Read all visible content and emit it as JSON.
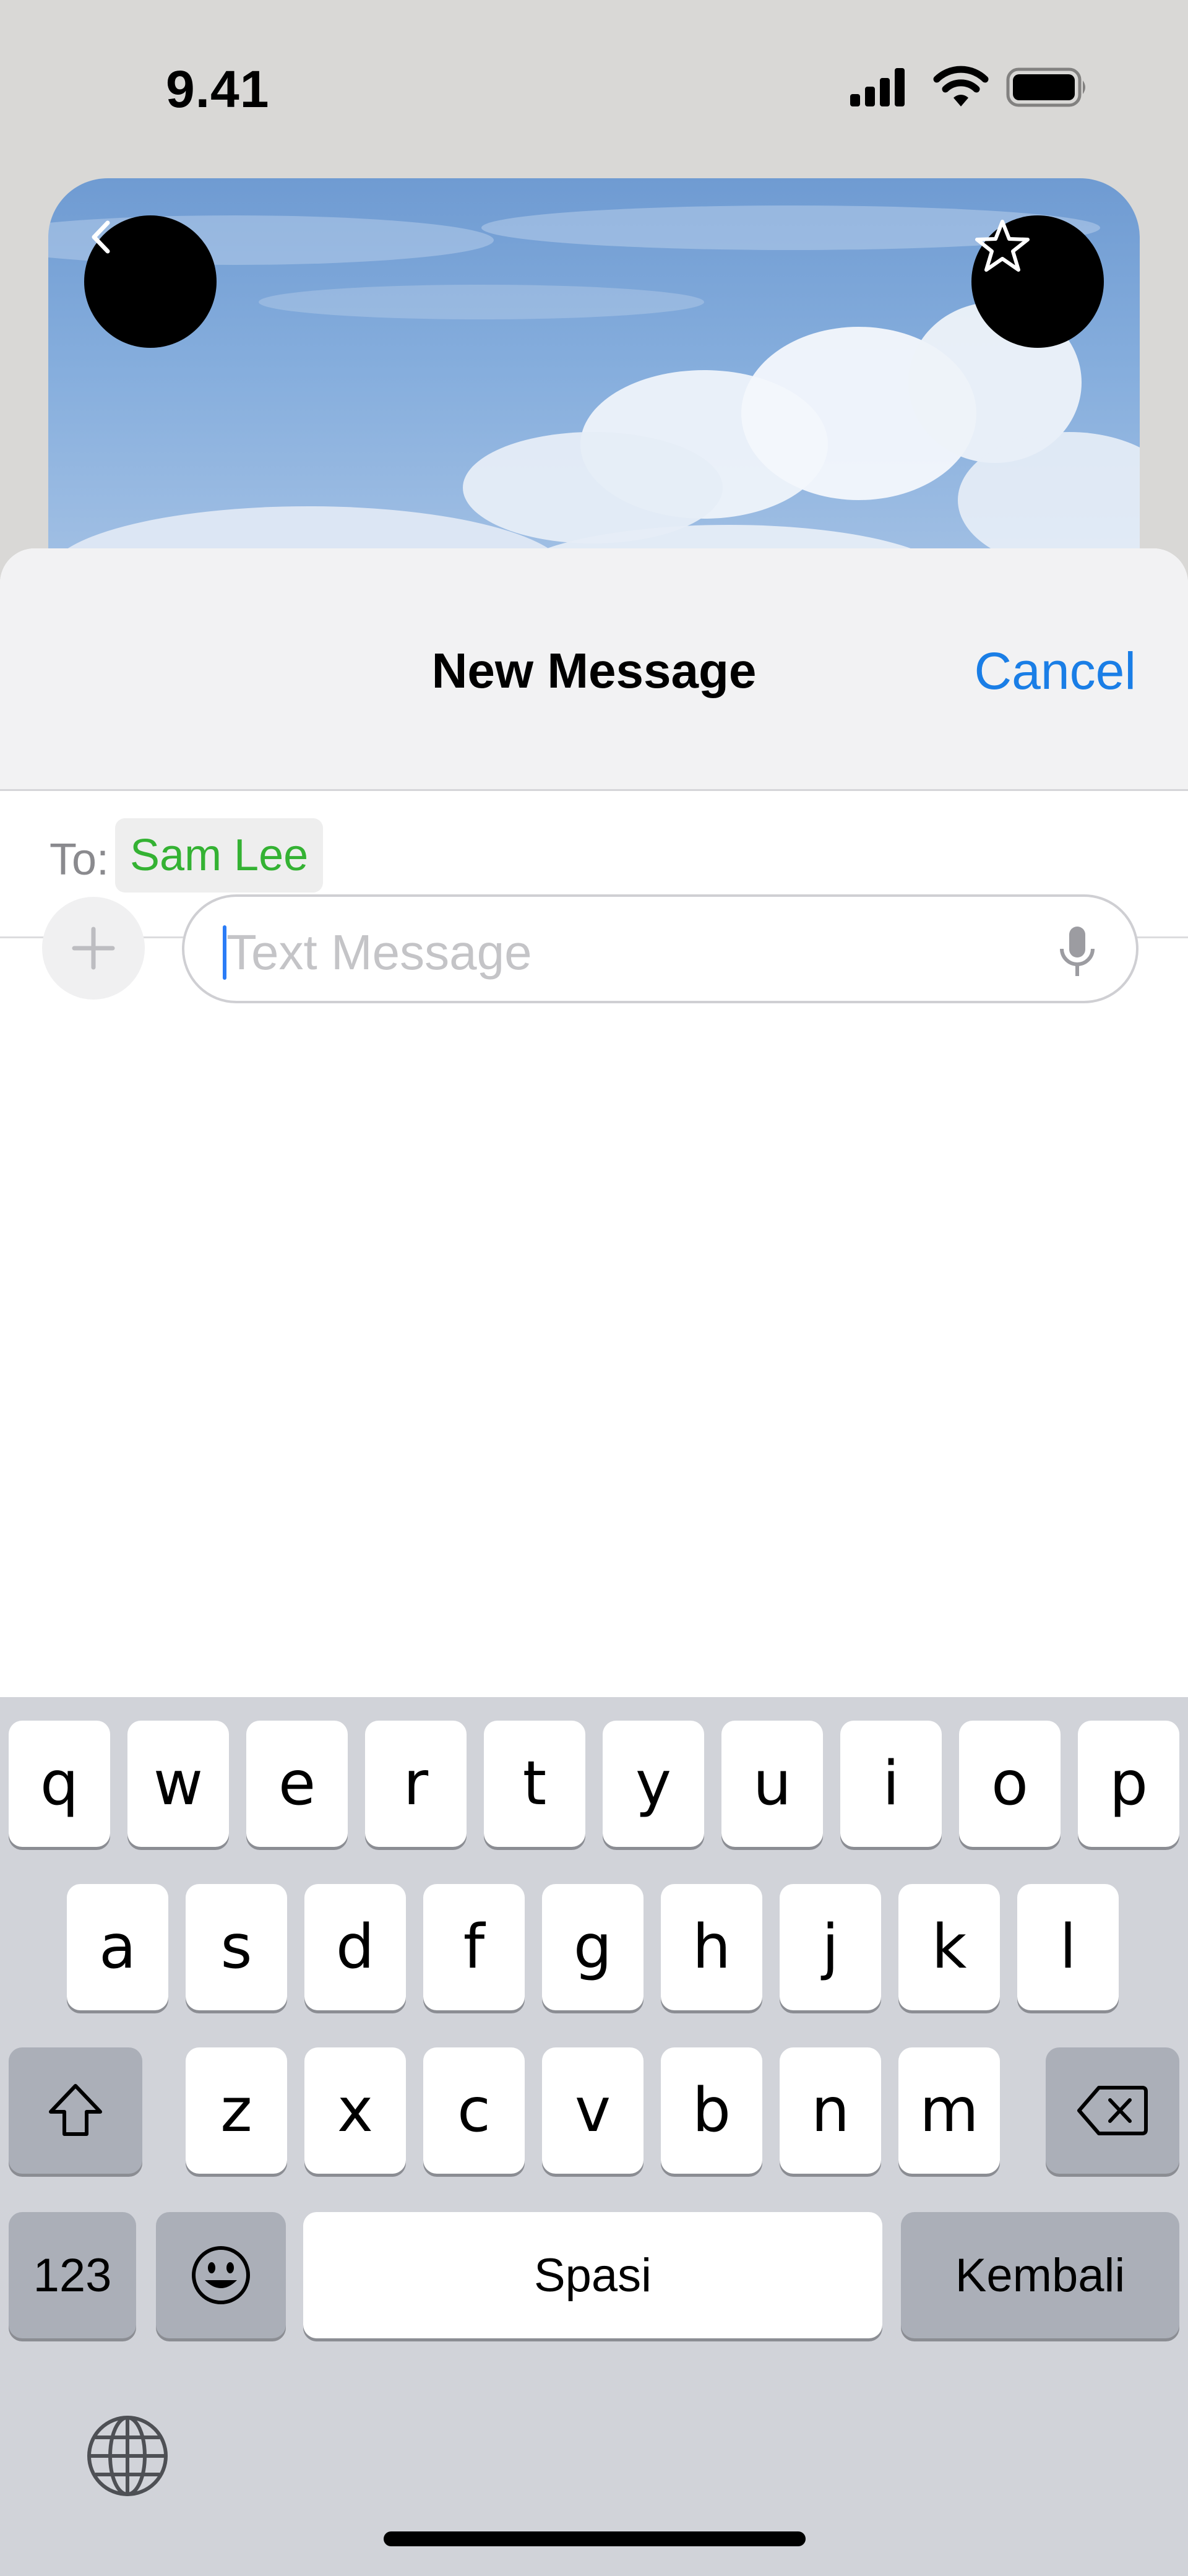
{
  "status_bar": {
    "time": "9.41",
    "icons": [
      "cellular-signal-icon",
      "wifi-icon",
      "battery-icon"
    ]
  },
  "header_card": {
    "back_icon": "chevron-left-icon",
    "favorite_icon": "star-icon"
  },
  "sheet": {
    "title": "New Message",
    "cancel_label": "Cancel"
  },
  "recipient": {
    "label": "To:",
    "name": "Sam Lee"
  },
  "composer": {
    "add_icon": "plus-icon",
    "placeholder": "Text Message",
    "value": "",
    "mic_icon": "microphone-icon"
  },
  "keyboard": {
    "row1": [
      "q",
      "w",
      "e",
      "r",
      "t",
      "y",
      "u",
      "i",
      "o",
      "p"
    ],
    "row2": [
      "a",
      "s",
      "d",
      "f",
      "g",
      "h",
      "j",
      "k",
      "l"
    ],
    "row3": [
      "z",
      "x",
      "c",
      "v",
      "b",
      "n",
      "m"
    ],
    "shift_icon": "shift-icon",
    "delete_icon": "delete-backspace-icon",
    "numbers_label": "123",
    "emoji_icon": "emoji-icon",
    "space_label": "Spasi",
    "return_label": "Kembali",
    "globe_icon": "globe-icon"
  },
  "colors": {
    "accent_blue": "#1a7ee6",
    "recipient_green": "#34b233",
    "keyboard_bg": "#d1d3d9",
    "function_key": "#abafb8"
  }
}
